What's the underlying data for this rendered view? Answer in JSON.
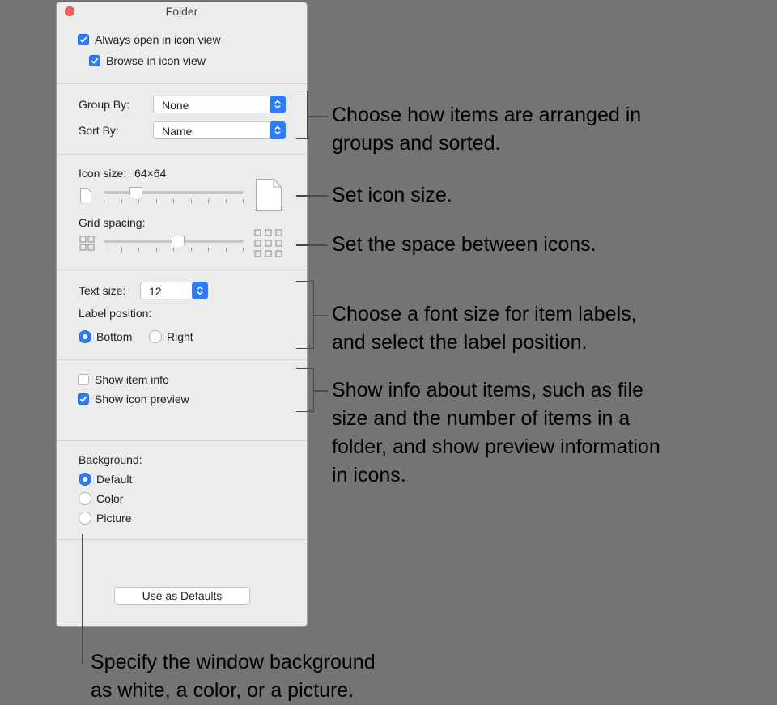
{
  "window": {
    "title": "Folder",
    "accent_color": "#2d7cf6",
    "close_color": "#fc5f57"
  },
  "view": {
    "always_open_label": "Always open in icon view",
    "always_open_checked": true,
    "browse_label": "Browse in icon view",
    "browse_checked": true
  },
  "arrange": {
    "group_by_label": "Group By:",
    "group_by_value": "None",
    "sort_by_label": "Sort By:",
    "sort_by_value": "Name"
  },
  "icons": {
    "icon_size_label": "Icon size:",
    "icon_size_value": "64×64",
    "icon_size_slider_fraction": 0.23,
    "grid_spacing_label": "Grid spacing:",
    "grid_spacing_slider_fraction": 0.53
  },
  "text": {
    "text_size_label": "Text size:",
    "text_size_value": "12",
    "label_position_label": "Label position:",
    "options": [
      "Bottom",
      "Right"
    ],
    "selected": "Bottom"
  },
  "info": {
    "show_item_info_label": "Show item info",
    "show_item_info_checked": false,
    "show_icon_preview_label": "Show icon preview",
    "show_icon_preview_checked": true
  },
  "background": {
    "label": "Background:",
    "options": [
      "Default",
      "Color",
      "Picture"
    ],
    "selected": "Default"
  },
  "defaults_button": "Use as Defaults",
  "callouts": {
    "arrange": [
      "Choose how items are arranged in",
      "groups and sorted."
    ],
    "icon_size": "Set icon size.",
    "spacing": "Set the space between icons.",
    "text": [
      "Choose a font size for item labels,",
      "and select the label position."
    ],
    "info": [
      "Show info about items, such as file",
      "size and the number of items in a",
      "folder, and show preview information",
      "in icons."
    ],
    "background": [
      "Specify the window background",
      "as white, a color, or a picture."
    ]
  }
}
